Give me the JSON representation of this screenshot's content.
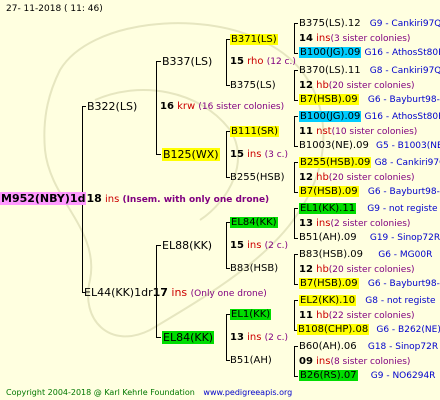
{
  "header": {
    "date_text": "27-  11-2018  ( 11: 46)"
  },
  "footer": {
    "copyright": "Copyright 2004-2018 @ Karl Kehrle Foundation",
    "website": "www.pedigreeapis.org"
  },
  "colors": {
    "background": "#ffffe0",
    "yellow": "#ffff00",
    "cyan": "#00ccff",
    "green": "#00dd00",
    "root": "#ff99ff",
    "red": "#cc0000",
    "blue": "#0000cc",
    "purple": "#800080"
  },
  "root": {
    "name": "M952(NBY)1d",
    "number": "18",
    "ins": "ins",
    "note": "(Insem. with only one drone)"
  },
  "gen1": [
    {
      "name": "B322(LS)",
      "number": "16",
      "suffix": "krw",
      "note": "(16 sister colonies)"
    },
    {
      "name": "EL44(KK)1dr",
      "number": "17",
      "suffix": "ins",
      "note": "(Only one drone)"
    }
  ],
  "gen2": [
    {
      "name": "B337(LS)",
      "number": "15",
      "suffix": "rho",
      "note": "(12 c.)"
    },
    {
      "name": "B125(WX)",
      "number": "15",
      "suffix": "ins",
      "note": "(3 c.)"
    },
    {
      "name": "EL88(KK)",
      "number": "15",
      "suffix": "ins",
      "note": "(2 c.)"
    },
    {
      "name": "EL84(KK)",
      "number": "13",
      "suffix": "ins",
      "note": "(2 c.)"
    }
  ],
  "gen3": [
    {
      "name": "B371(LS)"
    },
    {
      "name": "B375(LS)"
    },
    {
      "name": "B111(SR)"
    },
    {
      "name": "B255(HSB)"
    },
    {
      "name": "EL84(KK)"
    },
    {
      "name": "B83(HSB)"
    },
    {
      "name": "EL1(KK)"
    },
    {
      "name": "B51(AH)"
    }
  ],
  "gen4": [
    {
      "name": "B375(LS).12",
      "info": "G9 - Cankiri97Q"
    },
    {
      "number": "14",
      "suffix": "ins",
      "note": "(3 sister colonies)"
    },
    {
      "name": "B100(JG).09",
      "info": "G16 - AthosSt80R"
    },
    {
      "name": "B370(LS).11",
      "info": "G8 - Cankiri97Q"
    },
    {
      "number": "12",
      "suffix": "hb",
      "note": "(20 sister colonies)"
    },
    {
      "name": "B7(HSB).09",
      "info": "G6 - Bayburt98-3"
    },
    {
      "name": "B100(JG).09",
      "info": "G16 - AthosSt80R"
    },
    {
      "number": "11",
      "suffix": "nst",
      "note": "(10 sister colonies)"
    },
    {
      "name": "B1003(NE).09",
      "info": "G5 - B1003(NE)"
    },
    {
      "name": "B255(HSB).09",
      "info": "G8 - Cankiri97Q"
    },
    {
      "number": "12",
      "suffix": "hb",
      "note": "(20 sister colonies)"
    },
    {
      "name": "B7(HSB).09",
      "info": "G6 - Bayburt98-3"
    },
    {
      "name": "EL1(KK).11",
      "info": "G9 - not registe"
    },
    {
      "number": "13",
      "suffix": "ins",
      "note": "(2 sister colonies)"
    },
    {
      "name": "B51(AH).09",
      "info": "G19 - Sinop72R"
    },
    {
      "name": "B83(HSB).09",
      "info": "G6 - MG00R"
    },
    {
      "number": "12",
      "suffix": "hb",
      "note": "(20 sister colonies)"
    },
    {
      "name": "B7(HSB).09",
      "info": "G6 - Bayburt98-3"
    },
    {
      "name": "EL2(KK).10",
      "info": "G8 - not registe"
    },
    {
      "number": "11",
      "suffix": "hb",
      "note": "(22 sister colonies)"
    },
    {
      "name": "B108(CHP).08",
      "info": "G6 - B262(NE)"
    },
    {
      "name": "B60(AH).06",
      "info": "G18 - Sinop72R"
    },
    {
      "number": "09",
      "suffix": "ins",
      "note": "(8 sister colonies)"
    },
    {
      "name": "B26(RS).07",
      "info": "G9 - NO6294R"
    }
  ]
}
